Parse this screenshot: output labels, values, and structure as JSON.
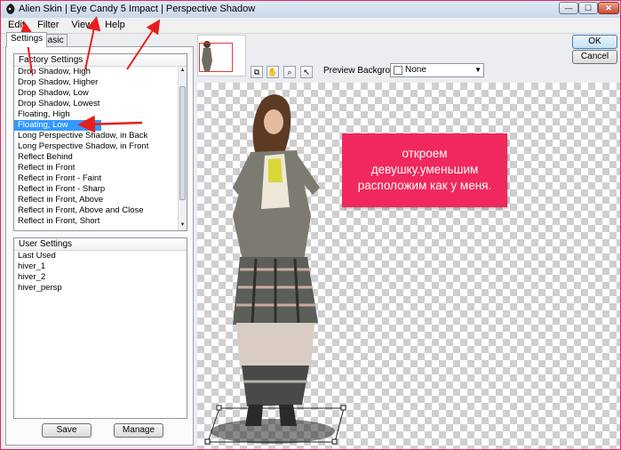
{
  "window": {
    "title": "Alien Skin | Eye Candy 5 Impact | Perspective Shadow",
    "min_glyph": "—",
    "max_glyph": "☐",
    "close_glyph": "✕"
  },
  "menu": [
    "Edit",
    "Filter",
    "View",
    "Help"
  ],
  "tabs": {
    "settings": "Settings",
    "basic": "Basic"
  },
  "factory_settings": {
    "header": "Factory Settings",
    "items": [
      "Drop Shadow, High",
      "Drop Shadow, Higher",
      "Drop Shadow, Low",
      "Drop Shadow, Lowest",
      "Floating, High",
      "Floating, Low",
      "Long Perspective Shadow, in Back",
      "Long Perspective Shadow, in Front",
      "Reflect Behind",
      "Reflect in Front",
      "Reflect in Front - Faint",
      "Reflect in Front - Sharp",
      "Reflect in Front, Above",
      "Reflect in Front, Above and Close",
      "Reflect in Front, Short"
    ],
    "selected": "Floating, Low"
  },
  "user_settings": {
    "header": "User Settings",
    "items": [
      "Last Used",
      "hiver_1",
      "hiver_2",
      "hiver_persp"
    ]
  },
  "buttons": {
    "save": "Save",
    "manage": "Manage",
    "ok": "OK",
    "cancel": "Cancel"
  },
  "preview": {
    "label": "Preview Background:",
    "selected": "None"
  },
  "annotation": {
    "lines": [
      "откроем",
      "девушку.уменьшим",
      "расположим как у меня."
    ],
    "color": "#f0285d"
  },
  "arrow_color": "#e81e1e"
}
